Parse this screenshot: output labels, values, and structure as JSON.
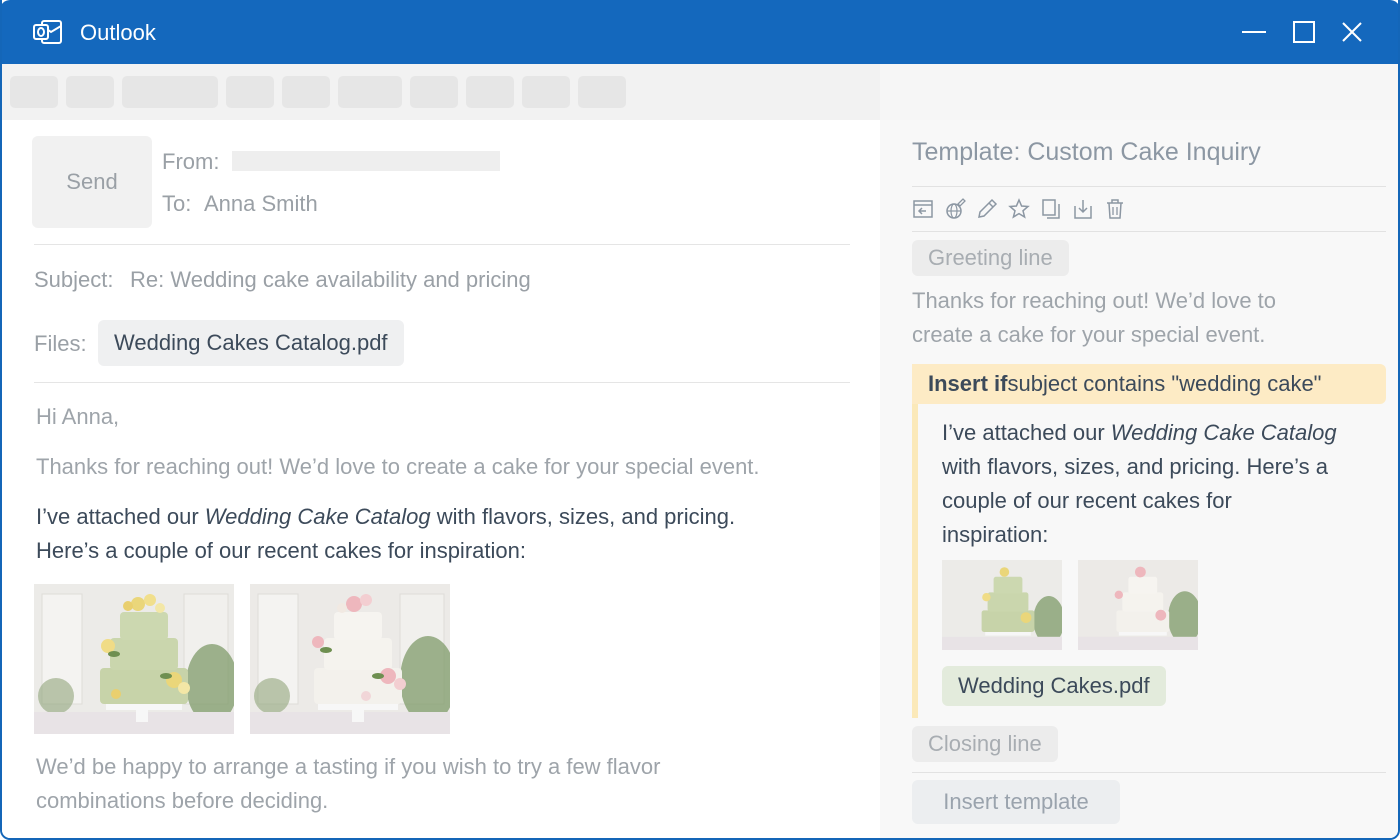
{
  "window": {
    "title": "Outlook",
    "accent_color": "#1468bd"
  },
  "compose": {
    "send_label": "Send",
    "from_label": "From:",
    "to_label": "To:",
    "to_value": "Anna Smith",
    "subject_label": "Subject:",
    "subject_value": "Re: Wedding cake availability and pricing",
    "files_label": "Files:",
    "attachment": "Wedding Cakes Catalog.pdf",
    "body": {
      "greeting": "Hi Anna,",
      "line1": "Thanks for reaching out! We’d love to create a cake for your special event.",
      "line2_pre": "I’ve attached our ",
      "line2_em": "Wedding Cake Catalog",
      "line2_post": " with flavors, sizes, and pricing.",
      "line3": "Here’s a couple of our recent cakes for inspiration:",
      "closing1": "We’d be happy to arrange a tasting if you wish to try a few flavor",
      "closing2": "combinations before deciding."
    },
    "images": [
      "green-wedding-cake",
      "white-wedding-cake"
    ]
  },
  "template": {
    "title": "Template: Custom Cake Inquiry",
    "toolbar_icons": [
      "insert-icon",
      "globe-edit-icon",
      "pencil-icon",
      "star-icon",
      "copy-icon",
      "download-icon",
      "trash-icon"
    ],
    "greeting_tag": "Greeting line",
    "intro1": "Thanks for reaching out! We’d love to",
    "intro2": "create a cake for your special event.",
    "condition": {
      "keyword": "Insert if",
      "rest": " subject contains \"wedding cake\"",
      "color": "#fdebc5"
    },
    "cond_line1_pre": "I’ve attached our ",
    "cond_line1_em": "Wedding Cake Catalog",
    "cond_line2": "with flavors, sizes, and pricing. Here’s a",
    "cond_line3": "couple of our recent cakes for",
    "cond_line4": "inspiration:",
    "attachment": "Wedding Cakes.pdf",
    "closing_tag": "Closing line",
    "insert_button": "Insert template"
  }
}
